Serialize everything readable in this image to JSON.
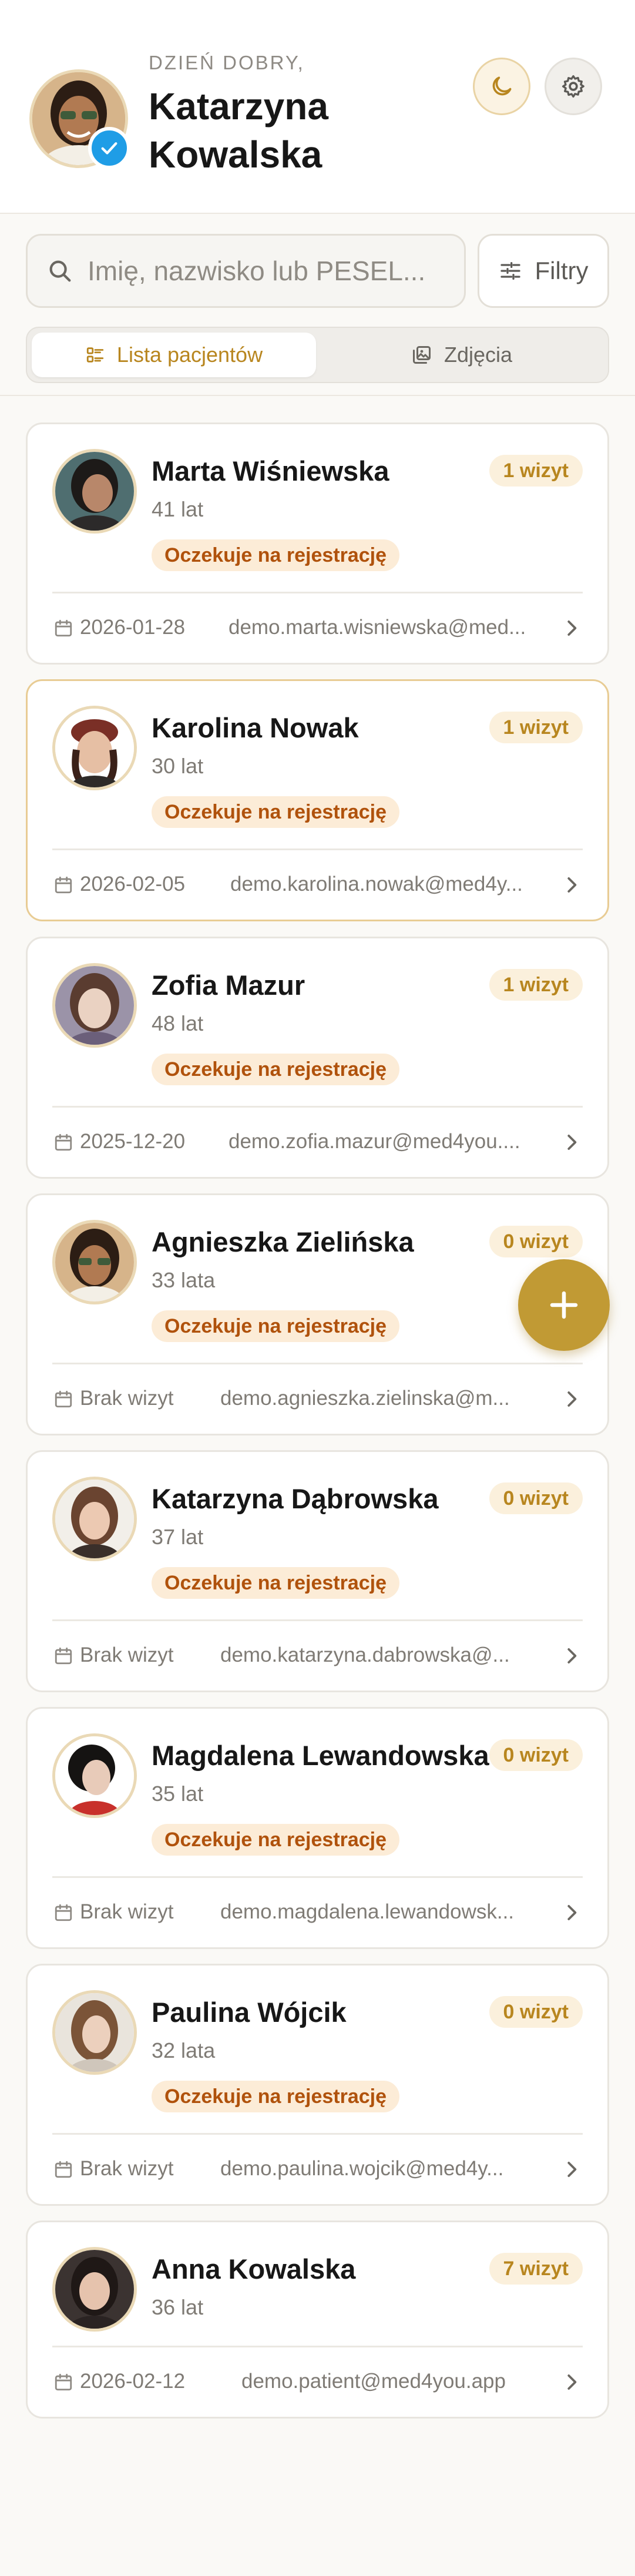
{
  "header": {
    "greeting": "DZIEŃ DOBRY,",
    "name_line1": "Katarzyna",
    "name_line2": "Kowalska",
    "icons": {
      "theme": "moon-icon",
      "settings": "gear-icon",
      "verified": "check-badge-icon"
    }
  },
  "search": {
    "placeholder": "Imię, nazwisko lub PESEL...",
    "value": "",
    "filter_label": "Filtry"
  },
  "tabs": [
    {
      "label": "Lista pacjentów",
      "active": true
    },
    {
      "label": "Zdjęcia",
      "active": false
    }
  ],
  "patients": [
    {
      "name": "Marta Wiśniewska",
      "age": "41 lat",
      "status": "Oczekuje na rejestrację",
      "visits": "1 wizyt",
      "date": "2026-01-28",
      "email": "demo.marta.wisniewska@med..."
    },
    {
      "name": "Karolina Nowak",
      "age": "30 lat",
      "status": "Oczekuje na rejestrację",
      "visits": "1 wizyt",
      "date": "2026-02-05",
      "email": "demo.karolina.nowak@med4y..."
    },
    {
      "name": "Zofia Mazur",
      "age": "48 lat",
      "status": "Oczekuje na rejestrację",
      "visits": "1 wizyt",
      "date": "2025-12-20",
      "email": "demo.zofia.mazur@med4you...."
    },
    {
      "name": "Agnieszka Zielińska",
      "age": "33 lata",
      "status": "Oczekuje na rejestrację",
      "visits": "0 wizyt",
      "date": "Brak wizyt",
      "email": "demo.agnieszka.zielinska@m..."
    },
    {
      "name": "Katarzyna Dąbrowska",
      "age": "37 lat",
      "status": "Oczekuje na rejestrację",
      "visits": "0 wizyt",
      "date": "Brak wizyt",
      "email": "demo.katarzyna.dabrowska@..."
    },
    {
      "name": "Magdalena Lewandowska",
      "age": "35 lat",
      "status": "Oczekuje na rejestrację",
      "visits": "0 wizyt",
      "date": "Brak wizyt",
      "email": "demo.magdalena.lewandowsk..."
    },
    {
      "name": "Paulina Wójcik",
      "age": "32 lata",
      "status": "Oczekuje na rejestrację",
      "visits": "0 wizyt",
      "date": "Brak wizyt",
      "email": "demo.paulina.wojcik@med4y..."
    },
    {
      "name": "Anna Kowalska",
      "age": "36 lat",
      "status": "",
      "visits": "7 wizyt",
      "date": "2026-02-12",
      "email": "demo.patient@med4you.app"
    }
  ],
  "fab": {
    "icon": "plus-icon"
  },
  "colors": {
    "accent": "#c19a34",
    "accent_text": "#b8861f",
    "status_text": "#b0520c",
    "status_bg": "#fcecd7",
    "verified": "#1f9de6"
  }
}
